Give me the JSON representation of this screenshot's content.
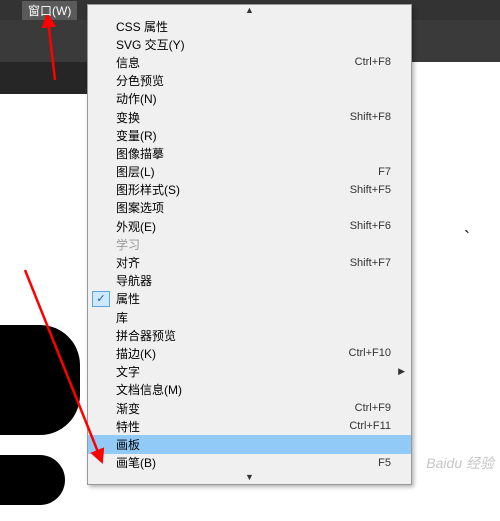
{
  "topbar": {
    "window_menu": "窗口(W)"
  },
  "menu": {
    "items": [
      {
        "label": "CSS 属性",
        "shortcut": "",
        "checked": false,
        "disabled": false,
        "submenu": false
      },
      {
        "label": "SVG 交互(Y)",
        "shortcut": "",
        "checked": false,
        "disabled": false,
        "submenu": false
      },
      {
        "label": "信息",
        "shortcut": "Ctrl+F8",
        "checked": false,
        "disabled": false,
        "submenu": false
      },
      {
        "label": "分色预览",
        "shortcut": "",
        "checked": false,
        "disabled": false,
        "submenu": false
      },
      {
        "label": "动作(N)",
        "shortcut": "",
        "checked": false,
        "disabled": false,
        "submenu": false
      },
      {
        "label": "变换",
        "shortcut": "Shift+F8",
        "checked": false,
        "disabled": false,
        "submenu": false
      },
      {
        "label": "变量(R)",
        "shortcut": "",
        "checked": false,
        "disabled": false,
        "submenu": false
      },
      {
        "label": "图像描摹",
        "shortcut": "",
        "checked": false,
        "disabled": false,
        "submenu": false
      },
      {
        "label": "图层(L)",
        "shortcut": "F7",
        "checked": false,
        "disabled": false,
        "submenu": false
      },
      {
        "label": "图形样式(S)",
        "shortcut": "Shift+F5",
        "checked": false,
        "disabled": false,
        "submenu": false
      },
      {
        "label": "图案选项",
        "shortcut": "",
        "checked": false,
        "disabled": false,
        "submenu": false
      },
      {
        "label": "外观(E)",
        "shortcut": "Shift+F6",
        "checked": false,
        "disabled": false,
        "submenu": false
      },
      {
        "label": "学习",
        "shortcut": "",
        "checked": false,
        "disabled": true,
        "submenu": false
      },
      {
        "label": "对齐",
        "shortcut": "Shift+F7",
        "checked": false,
        "disabled": false,
        "submenu": false
      },
      {
        "label": "导航器",
        "shortcut": "",
        "checked": false,
        "disabled": false,
        "submenu": false
      },
      {
        "label": "属性",
        "shortcut": "",
        "checked": true,
        "disabled": false,
        "submenu": false
      },
      {
        "label": "库",
        "shortcut": "",
        "checked": false,
        "disabled": false,
        "submenu": false
      },
      {
        "label": "拼合器预览",
        "shortcut": "",
        "checked": false,
        "disabled": false,
        "submenu": false
      },
      {
        "label": "描边(K)",
        "shortcut": "Ctrl+F10",
        "checked": false,
        "disabled": false,
        "submenu": false
      },
      {
        "label": "文字",
        "shortcut": "",
        "checked": false,
        "disabled": false,
        "submenu": true
      },
      {
        "label": "文档信息(M)",
        "shortcut": "",
        "checked": false,
        "disabled": false,
        "submenu": false
      },
      {
        "label": "渐变",
        "shortcut": "Ctrl+F9",
        "checked": false,
        "disabled": false,
        "submenu": false
      },
      {
        "label": "特性",
        "shortcut": "Ctrl+F11",
        "checked": false,
        "disabled": false,
        "submenu": false
      },
      {
        "label": "画板",
        "shortcut": "",
        "checked": false,
        "disabled": false,
        "submenu": false,
        "highlight": true
      },
      {
        "label": "画笔(B)",
        "shortcut": "F5",
        "checked": false,
        "disabled": false,
        "submenu": false
      }
    ]
  },
  "annotations": {
    "arrow_color": "#ff0000",
    "watermark": "Baidu 经验"
  }
}
